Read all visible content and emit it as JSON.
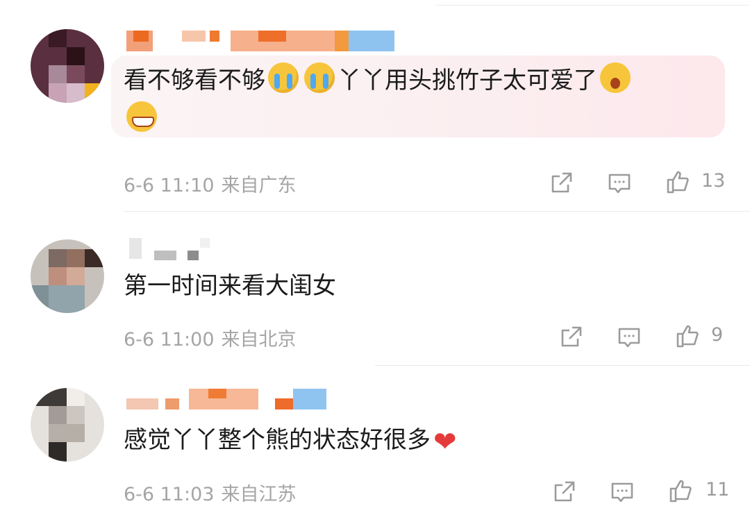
{
  "comments": [
    {
      "text_main": "看不够看不够",
      "emoji1": "crying-face-emoji",
      "emoji2": "crying-face-emoji",
      "text_after": "丫丫用头挑竹子太可爱了",
      "emoji3": "surprised-face-emoji",
      "emoji4": "grinning-face-emoji",
      "time": "6-6 11:10",
      "location": "来自广东",
      "likes": "13"
    },
    {
      "text": "第一时间来看大闺女",
      "time": "6-6 11:00",
      "location": "来自北京",
      "likes": "9"
    },
    {
      "text": "感觉丫丫整个熊的状态好很多",
      "heart": "❤",
      "time": "6-6 11:03",
      "location": "来自江苏",
      "likes": "11"
    }
  ],
  "icons": {
    "share": "share-icon",
    "reply": "reply-icon",
    "like": "thumbs-up-icon"
  },
  "colors": {
    "text": "#1b1b1b",
    "meta": "#a5a5a5",
    "heart": "#e53a3a",
    "highlight_bubble": "#fbeef0"
  }
}
